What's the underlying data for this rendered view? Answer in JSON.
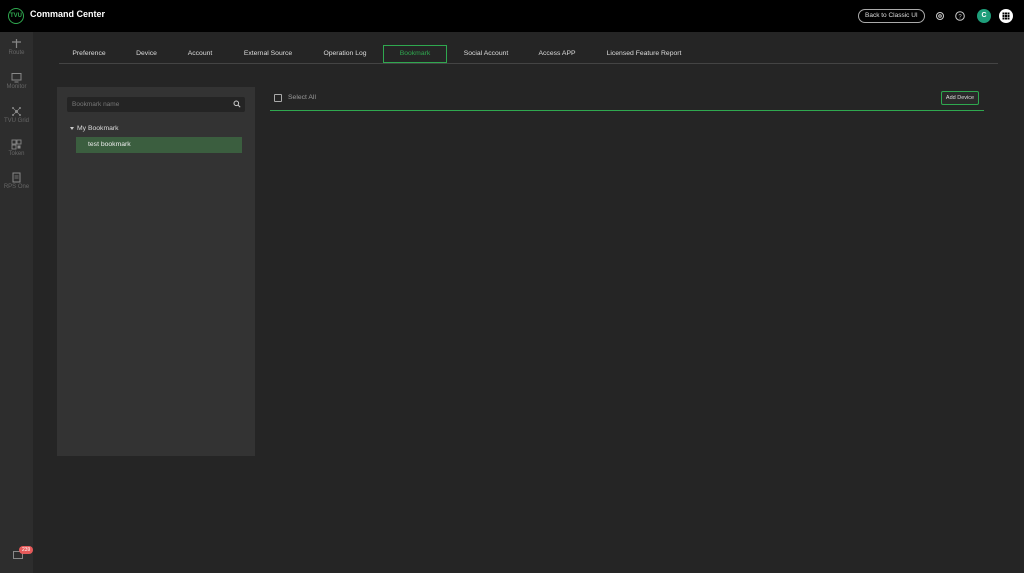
{
  "app": {
    "title": "Command Center",
    "logo_text": "TVU"
  },
  "header": {
    "back_button": "Back to Classic UI",
    "avatar_letter": "C"
  },
  "sidebar": {
    "items": [
      {
        "label": "Route",
        "icon": "route-icon"
      },
      {
        "label": "Monitor",
        "icon": "monitor-icon"
      },
      {
        "label": "TVU Grid",
        "icon": "grid-network-icon"
      },
      {
        "label": "Token",
        "icon": "qr-code-icon"
      },
      {
        "label": "RPS One",
        "icon": "device-icon"
      }
    ],
    "mail_badge": "239"
  },
  "tabs": [
    {
      "label": "Preference"
    },
    {
      "label": "Device"
    },
    {
      "label": "Account"
    },
    {
      "label": "External Source"
    },
    {
      "label": "Operation Log"
    },
    {
      "label": "Bookmark",
      "active": true
    },
    {
      "label": "Social Account"
    },
    {
      "label": "Access APP"
    },
    {
      "label": "Licensed Feature Report"
    }
  ],
  "bookmark_panel": {
    "search_placeholder": "Bookmark name",
    "tree": {
      "parent": "My Bookmark",
      "children": [
        "test bookmark"
      ]
    }
  },
  "device_panel": {
    "select_all": "Select All",
    "add_device": "Add Device"
  },
  "colors": {
    "accent": "#2fa84f",
    "selected_row": "#3b5e3f",
    "badge": "#e65a5a",
    "avatar": "#1e9e7a"
  }
}
